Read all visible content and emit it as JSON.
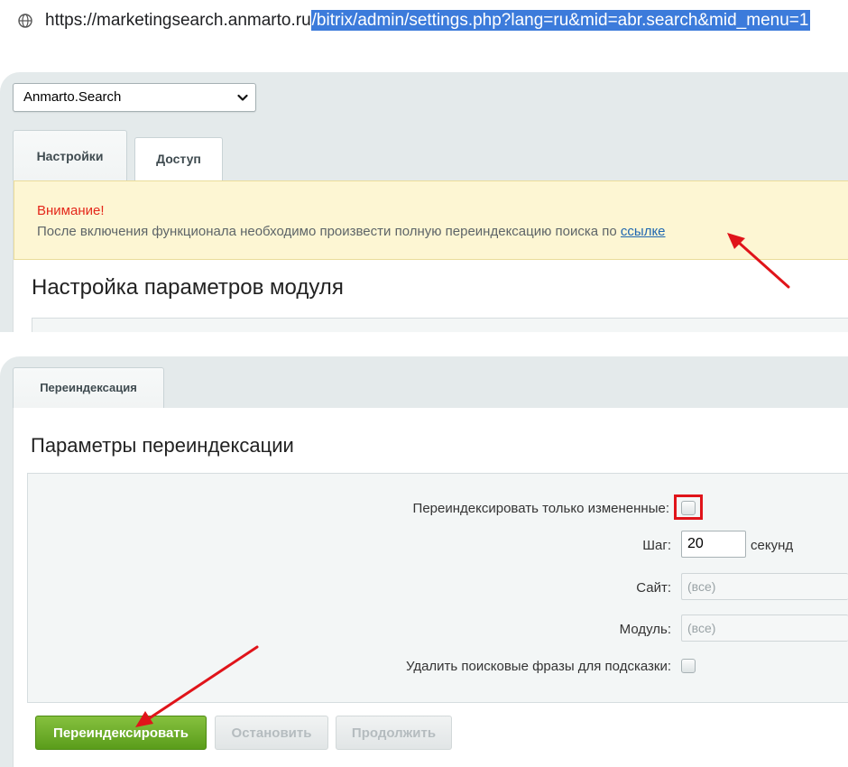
{
  "browser": {
    "url_plain": "https://marketingsearch.anmarto.ru",
    "url_selected": "/bitrix/admin/settings.php?lang=ru&mid=abr.search&mid_menu=1"
  },
  "settings_panel": {
    "module_select": "Anmarto.Search",
    "tabs": [
      {
        "label": "Настройки",
        "active": true
      },
      {
        "label": "Доступ",
        "active": false
      }
    ],
    "warning": {
      "title": "Внимание!",
      "text": "После включения функционала необходимо произвести полную переиндексацию поиска по",
      "link": "ссылке"
    },
    "section_title": "Настройка параметров модуля"
  },
  "reindex_panel": {
    "tab": "Переиндексация",
    "title": "Параметры переиндексации",
    "fields": {
      "only_changed_label": "Переиндексировать только измененные:",
      "step_label": "Шаг:",
      "step_value": "20",
      "step_unit": "секунд",
      "site_label": "Сайт:",
      "site_value": "(все)",
      "module_label": "Модуль:",
      "module_value": "(все)",
      "delete_phrases_label": "Удалить поисковые фразы для подсказки:"
    },
    "buttons": {
      "reindex": "Переиндексировать",
      "stop": "Остановить",
      "continue": "Продолжить"
    }
  },
  "colors": {
    "annotation_red": "#e0141a",
    "accent_green": "#5a9d1b",
    "link_blue": "#2067b0",
    "url_highlight": "#3c7bdb"
  }
}
